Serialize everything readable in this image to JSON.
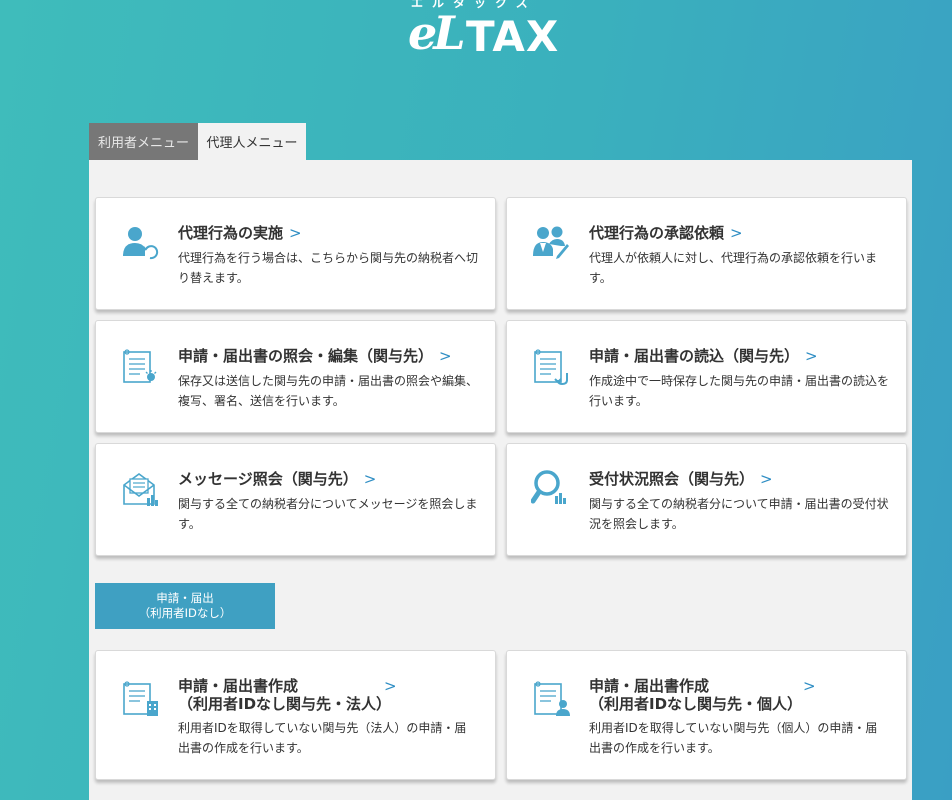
{
  "logo": {
    "kana": "エルタックス",
    "mark": "eL",
    "word": "TAX"
  },
  "tabs": [
    {
      "label": "利用者メニュー",
      "active": false
    },
    {
      "label": "代理人メニュー",
      "active": true
    }
  ],
  "cards": [
    {
      "icon": "agent-switch-icon",
      "title": "代理行為の実施",
      "desc": "代理行為を行う場合は、こちらから関与先の納税者へ切り替えます。"
    },
    {
      "icon": "agent-approval-icon",
      "title": "代理行為の承認依頼",
      "desc": "代理人が依頼人に対し、代理行為の承認依頼を行います。"
    },
    {
      "icon": "document-search-icon",
      "title": "申請・届出書の照会・編集（関与先）",
      "desc": "保存又は送信した関与先の申請・届出書の照会や編集、複写、署名、送信を行います。"
    },
    {
      "icon": "document-load-icon",
      "title": "申請・届出書の読込（関与先）",
      "desc": "作成途中で一時保存した関与先の申請・届出書の読込を行います。"
    },
    {
      "icon": "message-icon",
      "title": "メッセージ照会（関与先）",
      "desc": "関与する全ての納税者分についてメッセージを照会します。"
    },
    {
      "icon": "status-search-icon",
      "title": "受付状況照会（関与先）",
      "desc": "関与する全ての納税者分について申請・届出書の受付状況を照会します。"
    }
  ],
  "section": {
    "line1": "申請・届出",
    "line2": "（利用者IDなし）"
  },
  "bottom_cards": [
    {
      "icon": "document-corporation-icon",
      "title_line1": "申請・届出書作成",
      "title_line2": "（利用者IDなし関与先・法人）",
      "desc": "利用者IDを取得していない関与先（法人）の申請・届出書の作成を行います。"
    },
    {
      "icon": "document-individual-icon",
      "title_line1": "申請・届出書作成",
      "title_line2": "（利用者IDなし関与先・個人）",
      "desc": "利用者IDを取得していない関与先（個人）の申請・届出書の作成を行います。"
    }
  ],
  "chevron": ">",
  "colors": {
    "accent": "#2f8ec4",
    "icon": "#4aa6cc",
    "background": "#3fb6bd",
    "section_button": "#3fa0c2"
  }
}
